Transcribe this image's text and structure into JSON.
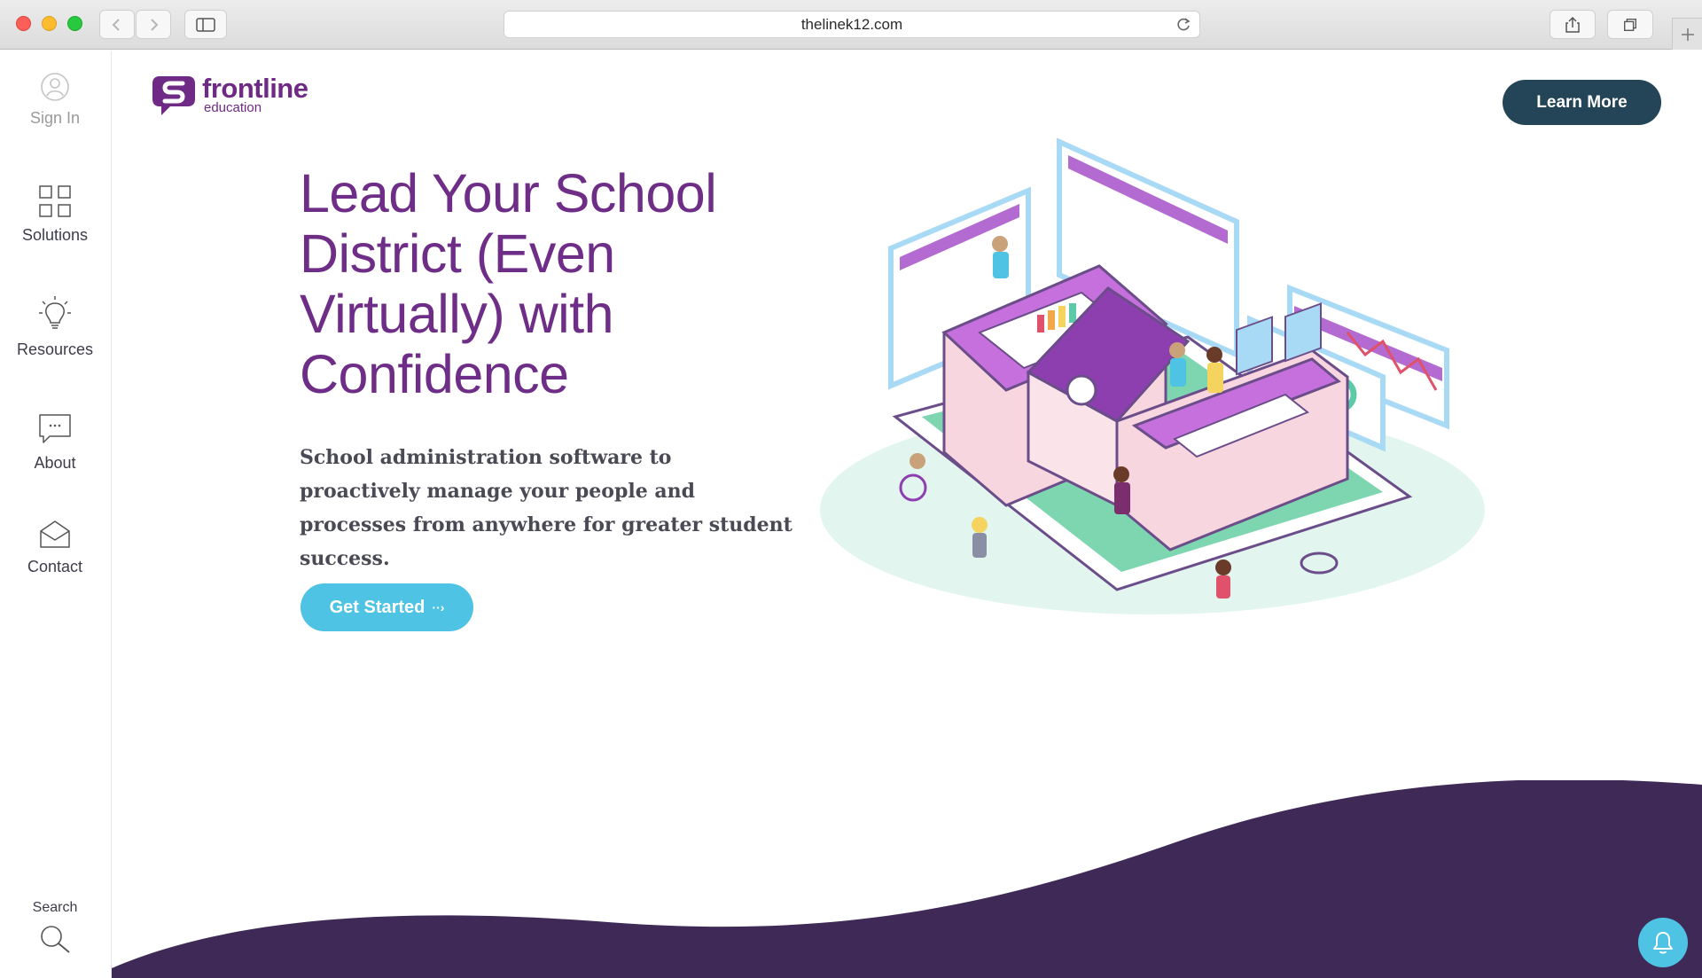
{
  "browser": {
    "url": "thelinek12.com"
  },
  "sidebar": {
    "items": [
      {
        "label": "Sign In",
        "icon": "user-circle-icon"
      },
      {
        "label": "Solutions",
        "icon": "grid-icon"
      },
      {
        "label": "Resources",
        "icon": "lightbulb-icon"
      },
      {
        "label": "About",
        "icon": "chat-bubble-icon"
      },
      {
        "label": "Contact",
        "icon": "envelope-icon"
      }
    ],
    "search_label": "Search"
  },
  "brand": {
    "name": "frontline",
    "sub": "education",
    "color": "#6e2d86"
  },
  "header": {
    "cta_label": "Learn More"
  },
  "hero": {
    "headline": "Lead Your School District (Even Virtually) with Confidence",
    "subtext": "School administration software to proactively manage your people and processes from anywhere for greater student success.",
    "button_label": "Get Started",
    "button_arrow": "··›"
  },
  "colors": {
    "accent": "#4ec3e3",
    "dark_button": "#234557",
    "wave": "#3f2a57",
    "purple": "#6e2d86"
  }
}
